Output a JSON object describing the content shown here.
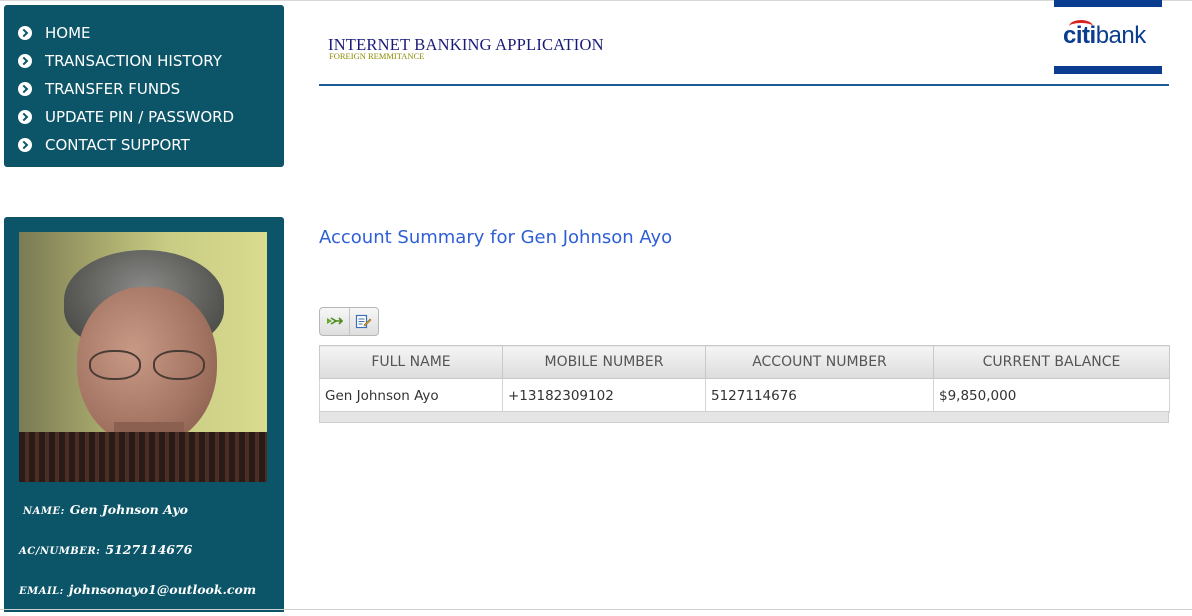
{
  "nav": {
    "items": [
      {
        "label": "HOME"
      },
      {
        "label": "TRANSACTION HISTORY"
      },
      {
        "label": "TRANSFER FUNDS"
      },
      {
        "label": "UPDATE PIN / PASSWORD"
      },
      {
        "label": "CONTACT SUPPORT"
      }
    ]
  },
  "header": {
    "title": "INTERNET BANKING APPLICATION",
    "subtitle": "FOREIGN REMMITANCE",
    "logo_citi": "citi",
    "logo_bank": "bank"
  },
  "profile": {
    "name_label": "NAME:",
    "name_value": "Gen Johnson Ayo",
    "acnumber_label": "AC/NUMBER:",
    "acnumber_value": "5127114676",
    "email_label": "EMAIL:",
    "email_value": "johnsonayo1@outlook.com"
  },
  "summary": {
    "title": "Account Summary for Gen Johnson Ayo",
    "toolbar_icons": [
      "export-icon",
      "edit-icon"
    ],
    "columns": [
      "FULL NAME",
      "MOBILE NUMBER",
      "ACCOUNT NUMBER",
      "CURRENT BALANCE"
    ],
    "rows": [
      [
        "Gen Johnson Ayo",
        "+13182309102",
        "5127114676",
        "$9,850,000"
      ]
    ]
  },
  "colors": {
    "panel": "#0c5569",
    "accent_blue": "#2f5fd6",
    "brand_blue": "#0a3d8f",
    "brand_red": "#d9231f"
  }
}
